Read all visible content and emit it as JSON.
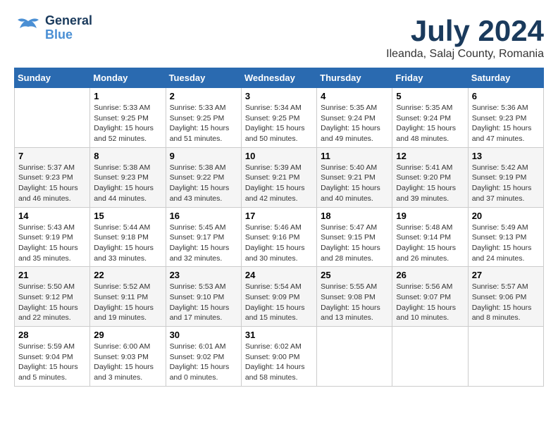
{
  "logo": {
    "general": "General",
    "blue": "Blue"
  },
  "title": "July 2024",
  "location": "Ileanda, Salaj County, Romania",
  "days_of_week": [
    "Sunday",
    "Monday",
    "Tuesday",
    "Wednesday",
    "Thursday",
    "Friday",
    "Saturday"
  ],
  "weeks": [
    [
      {
        "day": "",
        "info": ""
      },
      {
        "day": "1",
        "info": "Sunrise: 5:33 AM\nSunset: 9:25 PM\nDaylight: 15 hours\nand 52 minutes."
      },
      {
        "day": "2",
        "info": "Sunrise: 5:33 AM\nSunset: 9:25 PM\nDaylight: 15 hours\nand 51 minutes."
      },
      {
        "day": "3",
        "info": "Sunrise: 5:34 AM\nSunset: 9:25 PM\nDaylight: 15 hours\nand 50 minutes."
      },
      {
        "day": "4",
        "info": "Sunrise: 5:35 AM\nSunset: 9:24 PM\nDaylight: 15 hours\nand 49 minutes."
      },
      {
        "day": "5",
        "info": "Sunrise: 5:35 AM\nSunset: 9:24 PM\nDaylight: 15 hours\nand 48 minutes."
      },
      {
        "day": "6",
        "info": "Sunrise: 5:36 AM\nSunset: 9:23 PM\nDaylight: 15 hours\nand 47 minutes."
      }
    ],
    [
      {
        "day": "7",
        "info": "Sunrise: 5:37 AM\nSunset: 9:23 PM\nDaylight: 15 hours\nand 46 minutes."
      },
      {
        "day": "8",
        "info": "Sunrise: 5:38 AM\nSunset: 9:23 PM\nDaylight: 15 hours\nand 44 minutes."
      },
      {
        "day": "9",
        "info": "Sunrise: 5:38 AM\nSunset: 9:22 PM\nDaylight: 15 hours\nand 43 minutes."
      },
      {
        "day": "10",
        "info": "Sunrise: 5:39 AM\nSunset: 9:21 PM\nDaylight: 15 hours\nand 42 minutes."
      },
      {
        "day": "11",
        "info": "Sunrise: 5:40 AM\nSunset: 9:21 PM\nDaylight: 15 hours\nand 40 minutes."
      },
      {
        "day": "12",
        "info": "Sunrise: 5:41 AM\nSunset: 9:20 PM\nDaylight: 15 hours\nand 39 minutes."
      },
      {
        "day": "13",
        "info": "Sunrise: 5:42 AM\nSunset: 9:19 PM\nDaylight: 15 hours\nand 37 minutes."
      }
    ],
    [
      {
        "day": "14",
        "info": "Sunrise: 5:43 AM\nSunset: 9:19 PM\nDaylight: 15 hours\nand 35 minutes."
      },
      {
        "day": "15",
        "info": "Sunrise: 5:44 AM\nSunset: 9:18 PM\nDaylight: 15 hours\nand 33 minutes."
      },
      {
        "day": "16",
        "info": "Sunrise: 5:45 AM\nSunset: 9:17 PM\nDaylight: 15 hours\nand 32 minutes."
      },
      {
        "day": "17",
        "info": "Sunrise: 5:46 AM\nSunset: 9:16 PM\nDaylight: 15 hours\nand 30 minutes."
      },
      {
        "day": "18",
        "info": "Sunrise: 5:47 AM\nSunset: 9:15 PM\nDaylight: 15 hours\nand 28 minutes."
      },
      {
        "day": "19",
        "info": "Sunrise: 5:48 AM\nSunset: 9:14 PM\nDaylight: 15 hours\nand 26 minutes."
      },
      {
        "day": "20",
        "info": "Sunrise: 5:49 AM\nSunset: 9:13 PM\nDaylight: 15 hours\nand 24 minutes."
      }
    ],
    [
      {
        "day": "21",
        "info": "Sunrise: 5:50 AM\nSunset: 9:12 PM\nDaylight: 15 hours\nand 22 minutes."
      },
      {
        "day": "22",
        "info": "Sunrise: 5:52 AM\nSunset: 9:11 PM\nDaylight: 15 hours\nand 19 minutes."
      },
      {
        "day": "23",
        "info": "Sunrise: 5:53 AM\nSunset: 9:10 PM\nDaylight: 15 hours\nand 17 minutes."
      },
      {
        "day": "24",
        "info": "Sunrise: 5:54 AM\nSunset: 9:09 PM\nDaylight: 15 hours\nand 15 minutes."
      },
      {
        "day": "25",
        "info": "Sunrise: 5:55 AM\nSunset: 9:08 PM\nDaylight: 15 hours\nand 13 minutes."
      },
      {
        "day": "26",
        "info": "Sunrise: 5:56 AM\nSunset: 9:07 PM\nDaylight: 15 hours\nand 10 minutes."
      },
      {
        "day": "27",
        "info": "Sunrise: 5:57 AM\nSunset: 9:06 PM\nDaylight: 15 hours\nand 8 minutes."
      }
    ],
    [
      {
        "day": "28",
        "info": "Sunrise: 5:59 AM\nSunset: 9:04 PM\nDaylight: 15 hours\nand 5 minutes."
      },
      {
        "day": "29",
        "info": "Sunrise: 6:00 AM\nSunset: 9:03 PM\nDaylight: 15 hours\nand 3 minutes."
      },
      {
        "day": "30",
        "info": "Sunrise: 6:01 AM\nSunset: 9:02 PM\nDaylight: 15 hours\nand 0 minutes."
      },
      {
        "day": "31",
        "info": "Sunrise: 6:02 AM\nSunset: 9:00 PM\nDaylight: 14 hours\nand 58 minutes."
      },
      {
        "day": "",
        "info": ""
      },
      {
        "day": "",
        "info": ""
      },
      {
        "day": "",
        "info": ""
      }
    ]
  ]
}
